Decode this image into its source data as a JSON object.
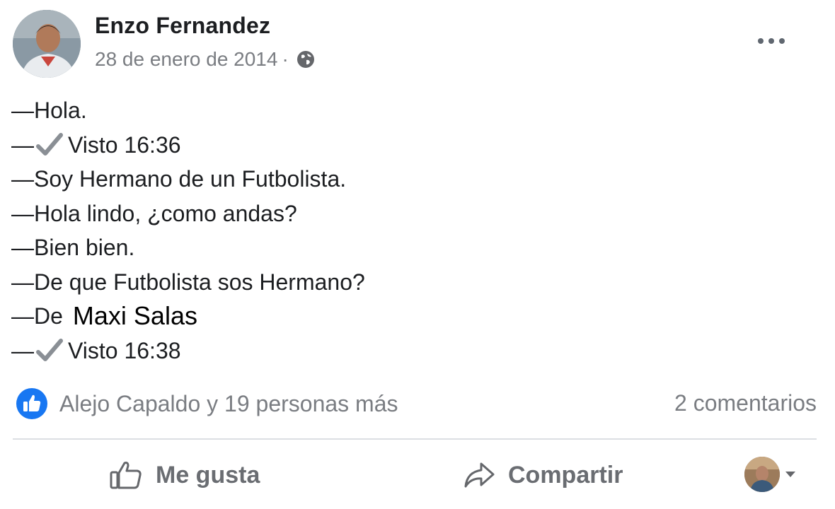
{
  "post": {
    "author": "Enzo Fernandez",
    "date": "28 de enero de 2014",
    "separator": "·",
    "lines": [
      {
        "prefix": "—",
        "text": "Hola."
      },
      {
        "prefix": "—",
        "check": true,
        "text": "Visto 16:36"
      },
      {
        "prefix": "—",
        "text": "Soy Hermano de un Futbolista."
      },
      {
        "prefix": "—",
        "text": "Hola lindo, ¿como andas?"
      },
      {
        "prefix": "—",
        "text": "Bien bien."
      },
      {
        "prefix": "—",
        "text": "De que Futbolista sos Hermano?"
      },
      {
        "prefix": "—",
        "text": "De",
        "overlay": "Maxi Salas"
      },
      {
        "prefix": "—",
        "check": true,
        "text": "Visto 16:38"
      }
    ]
  },
  "reactions": {
    "text": "Alejo Capaldo y 19 personas más",
    "comments": "2 comentarios"
  },
  "actions": {
    "like_label": "Me gusta",
    "share_label": "Compartir"
  },
  "icons": {
    "globe": "globe-icon",
    "more": "more-icon",
    "like_badge": "like-badge-icon",
    "thumbs_up": "thumbs-up-icon",
    "share": "share-icon",
    "check": "check-icon",
    "caret": "caret-down-icon"
  },
  "colors": {
    "like_blue": "#1877f2",
    "text": "#1c1e21",
    "secondary": "#7a7d82"
  }
}
